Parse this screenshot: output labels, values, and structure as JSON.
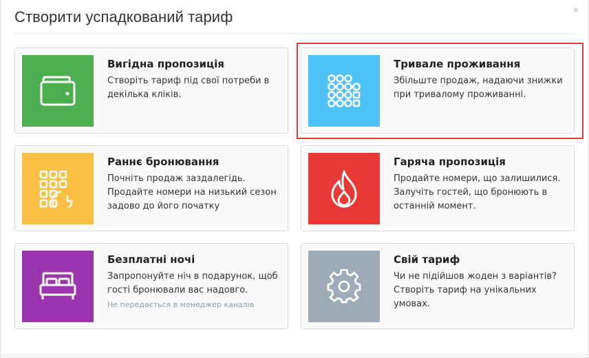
{
  "modal": {
    "title": "Створити успадкований тариф",
    "close_label": "×"
  },
  "cards": [
    {
      "title": "Вигідна пропозиція",
      "description": "Створіть тариф під свої потреби в декілька кліків.",
      "note": "",
      "icon": "wallet-icon",
      "color": "#4caf50"
    },
    {
      "title": "Тривале проживання",
      "description": "Збільште продаж, надаючи знижки при тривалому проживанні.",
      "note": "",
      "icon": "calendar-dots-icon",
      "color": "#4fc3f7"
    },
    {
      "title": "Раннє бронювання",
      "description": "Почніть продаж заздалегідь. Продайте номери на низький сезон задово до його початку",
      "note": "",
      "icon": "calendar-clock-icon",
      "color": "#f9c043"
    },
    {
      "title": "Гаряча пропозиція",
      "description": "Продайте номери, що залишилися. Залучіть гостей, що бронюють в останній момент.",
      "note": "",
      "icon": "flame-icon",
      "color": "#e83a34"
    },
    {
      "title": "Безплатні ночі",
      "description": "Запропонуйте ніч в подарунок, щоб гості бронювали вас надовго.",
      "note": "Не передається в менеджер каналів",
      "icon": "bed-icon",
      "color": "#9c34b0"
    },
    {
      "title": "Свій тариф",
      "description": "Чи не підійшов жоден з варіантів? Створіть тариф на унікальних умовах.",
      "note": "",
      "icon": "gear-icon",
      "color": "#9eaab7"
    }
  ]
}
